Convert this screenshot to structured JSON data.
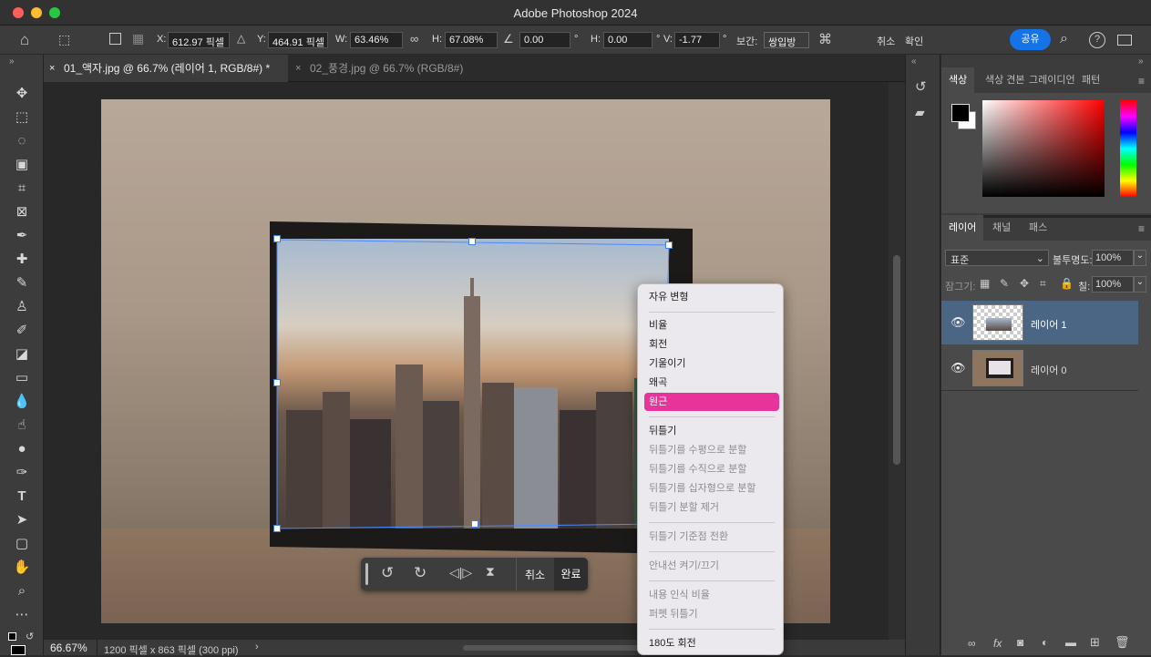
{
  "app": {
    "title": "Adobe Photoshop 2024"
  },
  "options": {
    "x_label": "X:",
    "x_value": "612.97 픽셀",
    "y_label": "Y:",
    "y_value": "464.91 픽셀",
    "w_label": "W:",
    "w_value": "63.46%",
    "h_label": "H:",
    "h_value": "67.08%",
    "rotate_value": "0.00",
    "rotate_unit": "°",
    "hskew_label": "H:",
    "hskew_value": "0.00",
    "hskew_unit": "°",
    "vskew_label": "V:",
    "vskew_value": "-1.77",
    "vskew_unit": "°",
    "interp_label": "보간:",
    "interp_value": "쌍입방",
    "cancel": "취소",
    "commit": "확인",
    "share": "공유"
  },
  "tabs": [
    {
      "label": "01_액자.jpg @ 66.7% (레이어 1, RGB/8#) *",
      "close": "×"
    },
    {
      "label": "02_풍경.jpg @ 66.7% (RGB/8#)",
      "close": "×"
    }
  ],
  "status": {
    "zoom": "66.67%",
    "doc": "1200 픽셀 x 863 픽셀 (300 ppi)",
    "arrow": "›"
  },
  "controlbar": {
    "cancel": "취소",
    "done": "완료"
  },
  "context_menu": {
    "items": [
      {
        "label": "자유 변형",
        "state": "normal"
      },
      {
        "label": "비율",
        "state": "normal"
      },
      {
        "label": "회전",
        "state": "normal"
      },
      {
        "label": "기울이기",
        "state": "normal"
      },
      {
        "label": "왜곡",
        "state": "normal"
      },
      {
        "label": "원근",
        "state": "highlighted"
      },
      {
        "label": "뒤틀기",
        "state": "normal"
      },
      {
        "label": "뒤틀기를 수평으로 분할",
        "state": "disabled"
      },
      {
        "label": "뒤틀기를 수직으로 분할",
        "state": "disabled"
      },
      {
        "label": "뒤틀기를 십자형으로 분할",
        "state": "disabled"
      },
      {
        "label": "뒤틀기 분할 제거",
        "state": "disabled"
      },
      {
        "label": "뒤틀기 기준점 전환",
        "state": "disabled"
      },
      {
        "label": "안내선 켜기/끄기",
        "state": "disabled"
      },
      {
        "label": "내용 인식 비율",
        "state": "disabled"
      },
      {
        "label": "퍼펫 뒤틀기",
        "state": "disabled"
      },
      {
        "label": "180도 회전",
        "state": "normal"
      }
    ]
  },
  "color_panel": {
    "tabs": [
      "색상",
      "색상 견본",
      "그레이디언",
      "패턴"
    ]
  },
  "layers_panel": {
    "tabs": [
      "레이어",
      "채널",
      "패스"
    ],
    "blend_mode": "표준",
    "opacity_label": "불투명도:",
    "opacity_value": "100%",
    "lock_label": "잠그기:",
    "fill_label": "칠:",
    "fill_value": "100%",
    "layers": [
      {
        "name": "레이어 1",
        "selected": true
      },
      {
        "name": "레이어 0",
        "selected": false
      }
    ]
  },
  "colors": {
    "accent": "#1473e6",
    "highlight": "#e8339a",
    "selected_layer": "#4b6584"
  }
}
